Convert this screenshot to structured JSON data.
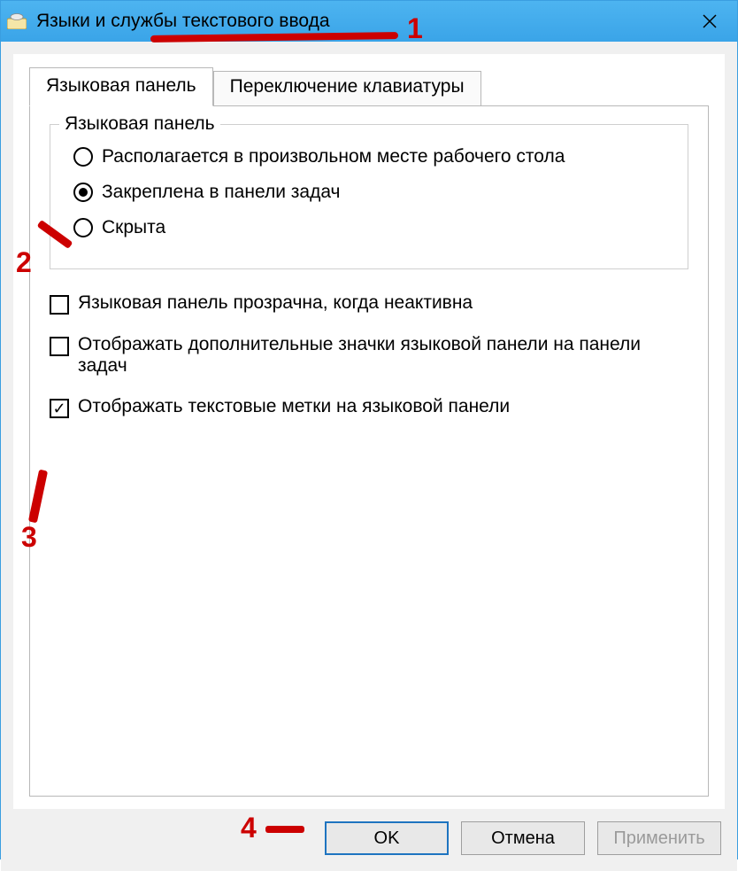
{
  "titlebar": {
    "title": "Языки и службы текстового ввода"
  },
  "tabs": [
    {
      "label": "Языковая панель",
      "active": true
    },
    {
      "label": "Переключение клавиатуры",
      "active": false
    }
  ],
  "fieldset": {
    "legend": "Языковая панель",
    "radios": [
      {
        "label": "Располагается в произвольном месте рабочего стола",
        "checked": false
      },
      {
        "label": "Закреплена в панели задач",
        "checked": true
      },
      {
        "label": "Скрыта",
        "checked": false
      }
    ]
  },
  "checkboxes": [
    {
      "label": "Языковая панель прозрачна, когда неактивна",
      "checked": false
    },
    {
      "label": "Отображать дополнительные значки языковой панели на панели задач",
      "checked": false
    },
    {
      "label": "Отображать текстовые метки на языковой панели",
      "checked": true
    }
  ],
  "buttons": {
    "ok": "OK",
    "cancel": "Отмена",
    "apply": "Применить"
  },
  "annotations": {
    "a1": "1",
    "a2": "2",
    "a3": "3",
    "a4": "4"
  }
}
